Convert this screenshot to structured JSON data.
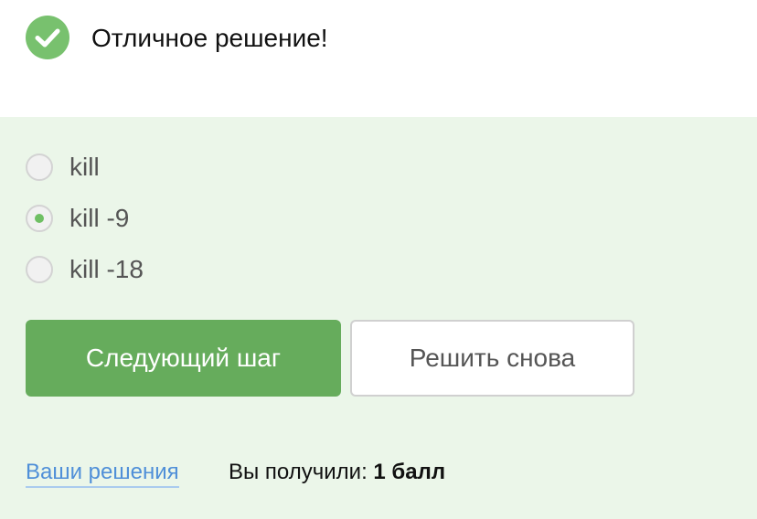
{
  "header": {
    "title": "Отличное решение!",
    "icon": "check-circle-icon",
    "icon_color": "#78c16e"
  },
  "question": {
    "options": [
      {
        "label": "kill",
        "selected": false
      },
      {
        "label": "kill -9",
        "selected": true
      },
      {
        "label": "kill -18",
        "selected": false
      }
    ]
  },
  "actions": {
    "next_label": "Следующий шаг",
    "retry_label": "Решить снова"
  },
  "footer": {
    "solutions_link": "Ваши решения",
    "score_prefix": "Вы получили:",
    "score_value": "1 балл"
  },
  "colors": {
    "panel_bg": "#ebf6e9",
    "primary": "#66ac5c",
    "link": "#4f8fd8"
  }
}
